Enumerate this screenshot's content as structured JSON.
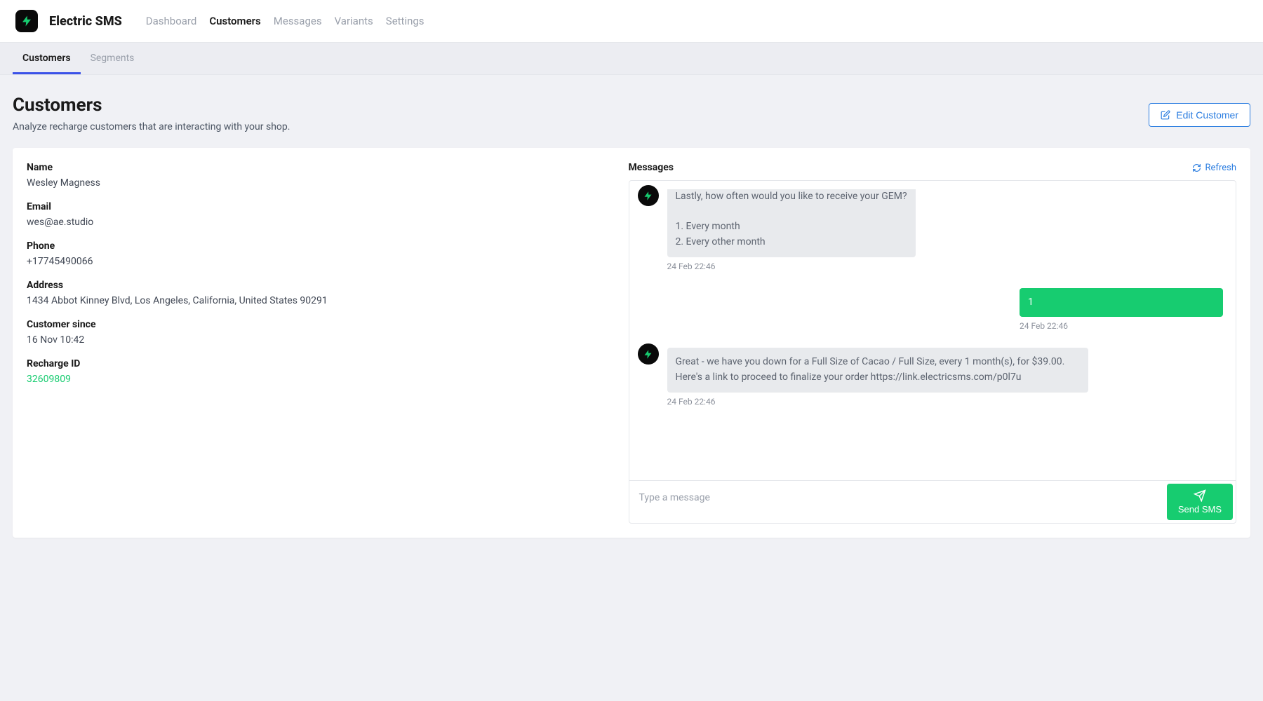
{
  "brand": "Electric SMS",
  "nav": {
    "items": [
      "Dashboard",
      "Customers",
      "Messages",
      "Variants",
      "Settings"
    ],
    "active": "Customers"
  },
  "subtabs": {
    "items": [
      "Customers",
      "Segments"
    ],
    "active": "Customers"
  },
  "page": {
    "title": "Customers",
    "subtitle": "Analyze recharge customers that are interacting with your shop.",
    "edit_button": "Edit Customer"
  },
  "customer": {
    "labels": {
      "name": "Name",
      "email": "Email",
      "phone": "Phone",
      "address": "Address",
      "since": "Customer since",
      "recharge_id": "Recharge ID"
    },
    "name": "Wesley Magness",
    "email": "wes@ae.studio",
    "phone": "+17745490066",
    "address": "1434 Abbot Kinney Blvd, Los Angeles, California, United States 90291",
    "since": "16 Nov 10:42",
    "recharge_id": "32609809"
  },
  "messages": {
    "title": "Messages",
    "refresh_label": "Refresh",
    "compose_placeholder": "Type a message",
    "send_label": "Send SMS",
    "items": [
      {
        "direction": "in",
        "text": "Lastly, how often would you like to receive your GEM?\n\n1. Every month\n2. Every other month",
        "time": "24 Feb 22:46"
      },
      {
        "direction": "out",
        "text": "1",
        "time": "24 Feb 22:46"
      },
      {
        "direction": "in",
        "text": "Great - we have you down for a Full Size of Cacao / Full Size, every 1 month(s), for $39.00. Here's a link to proceed to finalize your order https://link.electricsms.com/p0l7u",
        "time": "24 Feb 22:46"
      }
    ]
  }
}
